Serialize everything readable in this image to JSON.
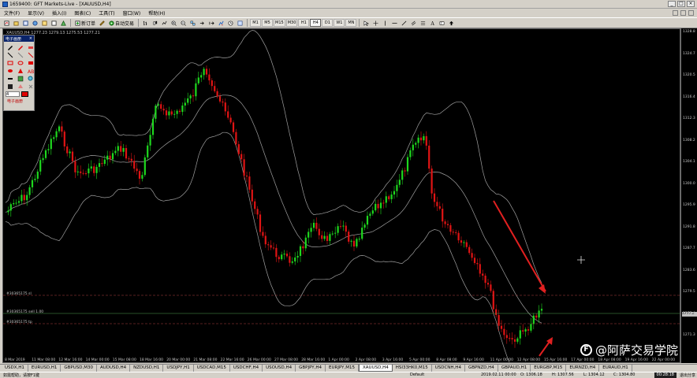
{
  "window": {
    "title": "1659400: GFT Markets-Live - [XAUUSD,H4]",
    "min": "_",
    "max": "□",
    "close": "×"
  },
  "menu": [
    "文件(F)",
    "显示(V)",
    "插入(I)",
    "图表(C)",
    "工具(T)",
    "窗口(W)",
    "帮助(H)"
  ],
  "toolbar": {
    "new_order": "新订单",
    "auto_trading": "自动交易",
    "timeframes": [
      "M1",
      "M5",
      "M15",
      "M30",
      "H1",
      "H4",
      "D1",
      "W1",
      "MN"
    ],
    "active_timeframe": "H4"
  },
  "chart": {
    "symbol_info": "XAUUSD,H4 1277.23 1279.13 1275.53 1277.21",
    "y_ticks": [
      "1328.8",
      "1324.7",
      "1320.5",
      "1316.4",
      "1312.3",
      "1308.2",
      "1304.1",
      "1300.0",
      "1295.9",
      "1291.8",
      "1287.7",
      "1283.6",
      "1279.5",
      "1275.4",
      "1271.3"
    ],
    "current_price": "1277.2",
    "x_ticks": [
      "8 Mar 2019",
      "11 Mar 08:00",
      "12 Mar 16:00",
      "14 Mar 00:00",
      "15 Mar 08:00",
      "18 Mar 16:00",
      "20 Mar 00:00",
      "21 Mar 08:00",
      "22 Mar 16:00",
      "26 Mar 00:00",
      "27 Mar 08:00",
      "28 Mar 16:00",
      "1 Apr 00:00",
      "2 Apr 08:00",
      "3 Apr 16:00",
      "5 Apr 00:00",
      "8 Apr 08:00",
      "9 Apr 16:00",
      "11 Apr 00:00",
      "12 Apr 08:00",
      "15 Apr 16:00",
      "17 Apr 00:00",
      "18 Apr 08:00",
      "19 Apr 16:00",
      "22 Apr 00:00"
    ],
    "order_lines": [
      {
        "label": "#30365175 sl",
        "color": "#c04040"
      },
      {
        "label": "#30365175 sell 1.00",
        "color": "#60a060"
      },
      {
        "label": "#30365175 tp",
        "color": "#c04040"
      }
    ]
  },
  "draw_panel": {
    "title": "电子画册",
    "close": "×",
    "width_value": "4",
    "footer": "电子画册"
  },
  "tabs": [
    "USDX,H1",
    "EURUSD,H1",
    "GBPUSD,M30",
    "AUDUSD,H4",
    "NZDUSD,H1",
    "USDJPY,H1",
    "USDCAD,M15",
    "USDCHF,H4",
    "USOUSD,H4",
    "GBPJPY,H4",
    "EURJPY,M15",
    "XAUUSD,H4",
    "HSI33HK0,M15",
    "USDCNH,H4",
    "GBPNZD,H4",
    "GBPAUD,H1",
    "EURGBP,M15",
    "EURNZD,H4",
    "EURAUD,H1"
  ],
  "active_tab": "XAUUSD,H4",
  "status": {
    "help": "如需帮助，请按F1键",
    "profile": "Default",
    "datetime": "2019.02.11 00:00",
    "open": "O: 1306.18",
    "high": "H: 1307.56",
    "low": "L: 1304.12",
    "close": "C: 1304.80",
    "traffic": "00:28:18",
    "exit": "退出分享"
  },
  "watermark": {
    "logo": "F",
    "text": "@阿萨交易学院"
  },
  "colors": {
    "bull": "#1ed81e",
    "bear": "#e01414",
    "bands": "#a0a0a0",
    "arrow": "#e02020"
  }
}
